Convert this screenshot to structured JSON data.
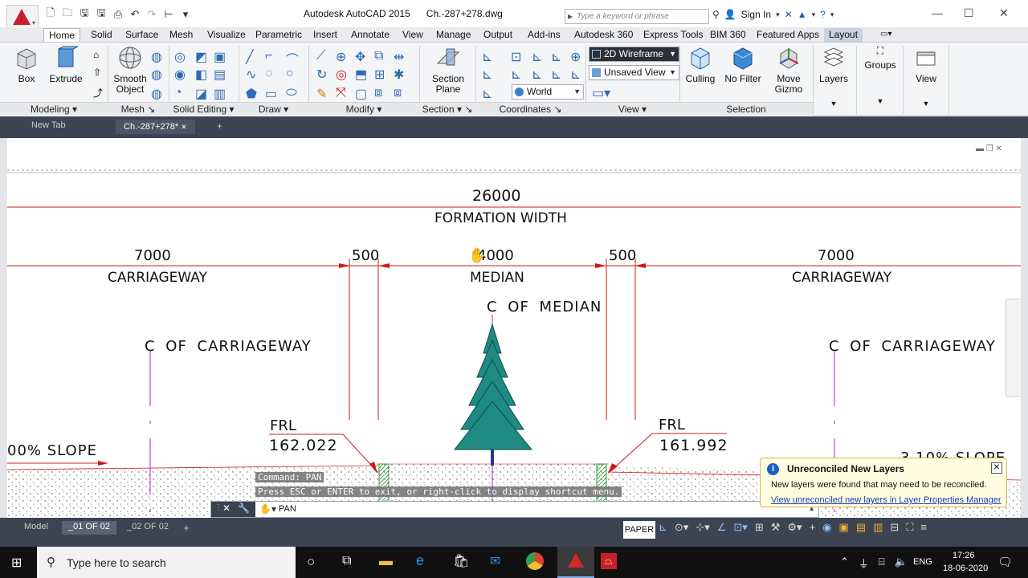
{
  "titlebar": {
    "app_title": "Autodesk AutoCAD 2015",
    "file_title": "Ch.-287+278.dwg",
    "search_placeholder": "Type a keyword or phrase",
    "sign_in": "Sign In"
  },
  "ribbon": {
    "tabs": [
      "Home",
      "Solid",
      "Surface",
      "Mesh",
      "Visualize",
      "Parametric",
      "Insert",
      "Annotate",
      "View",
      "Manage",
      "Output",
      "Add-ins",
      "Autodesk 360",
      "Express Tools",
      "BIM 360",
      "Featured Apps",
      "Layout"
    ],
    "active_tab": "Home",
    "buttons": {
      "box": "Box",
      "extrude": "Extrude",
      "smooth_object": "Smooth Object",
      "section_plane": "Section Plane",
      "culling": "Culling",
      "no_filter": "No Filter",
      "move_gizmo": "Move Gizmo",
      "layers": "Layers",
      "groups": "Groups",
      "view": "View"
    },
    "dropdowns": {
      "visual_style": "2D Wireframe",
      "named_view": "Unsaved View",
      "ucs": "World"
    },
    "panels": [
      "Modeling",
      "Mesh",
      "Solid Editing",
      "Draw",
      "Modify",
      "Section",
      "Coordinates",
      "View",
      "Selection"
    ]
  },
  "doc_tabs": {
    "new_tab": "New Tab",
    "active": "Ch.-287+278*"
  },
  "drawing": {
    "formation_width_value": "26000",
    "formation_width_label": "FORMATION WIDTH",
    "left_carriageway_value": "7000",
    "left_carriageway_label": "CARRIAGEWAY",
    "left_shoulder_value": "500",
    "median_value": "4000",
    "median_label": "MEDIAN",
    "right_shoulder_value": "500",
    "right_carriageway_value": "7000",
    "right_carriageway_label": "CARRIAGEWAY",
    "cl_median": "C OF MEDIAN",
    "cl_carriageway_left": "C OF CARRIAGEWAY",
    "cl_carriageway_right": "C OF CARRIAGEWAY",
    "frl_left_label": "FRL",
    "frl_left_value": "162.022",
    "frl_right_label": "FRL",
    "frl_right_value": "161.992",
    "slope_left": "00% SLOPE",
    "slope_right": "3.10% SLOPE"
  },
  "command": {
    "history_1": "Command: PAN",
    "history_2": "Press ESC or ENTER to exit, or right-click to display shortcut menu.",
    "input": "PAN"
  },
  "notification": {
    "title": "Unreconciled New Layers",
    "body": "New layers were found that may need to be reconciled.",
    "link": "View unreconciled new layers in Layer Properties Manager"
  },
  "status": {
    "layout_tabs": [
      "Model",
      "_01 OF 02",
      "_02 OF 02"
    ],
    "active_layout": "_01 OF 02",
    "paper": "PAPER"
  },
  "taskbar": {
    "search_placeholder": "Type here to search",
    "language": "ENG",
    "time": "17:26",
    "date": "18-06-2020"
  }
}
